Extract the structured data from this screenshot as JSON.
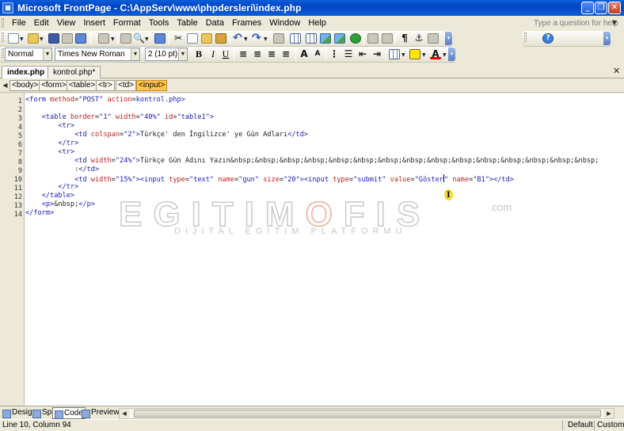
{
  "window": {
    "title": "Microsoft FrontPage - C:\\AppServ\\www\\phpdersleri\\index.php"
  },
  "menu": {
    "items": [
      "File",
      "Edit",
      "View",
      "Insert",
      "Format",
      "Tools",
      "Table",
      "Data",
      "Frames",
      "Window",
      "Help"
    ],
    "help_placeholder": "Type a question for help"
  },
  "formatting": {
    "style": "Normal",
    "font": "Times New Roman",
    "size": "2  (10 pt)",
    "bold": "B",
    "italic": "I",
    "underline": "U"
  },
  "doc_tabs": [
    {
      "label": "index.php",
      "active": true
    },
    {
      "label": "kontrol.php*",
      "active": false
    }
  ],
  "tag_path": [
    "<body>",
    "<form>",
    "<table>",
    "<tr>",
    "<td>",
    "<input>"
  ],
  "editor": {
    "line_numbers": [
      "1",
      "2",
      "3",
      "4",
      "5",
      "6",
      "7",
      "8",
      "9",
      "10",
      "11",
      "12",
      "13",
      "14"
    ]
  },
  "watermark": {
    "brand": "EGITIMOFIS",
    "tld": ".com",
    "tagline": "DIJITAL EGITIM PLATFORMU"
  },
  "view_tabs": [
    "Design",
    "Split",
    "Code",
    "Preview"
  ],
  "status": {
    "position": "Line 10, Column 94",
    "mode": "Default",
    "size": "Custom"
  },
  "colors": {
    "title_bar": "#0A5FD8",
    "tag_color": "#1a1ab8",
    "attr_color": "#c21f1f",
    "active_tag_highlight": "#ffc54d"
  }
}
